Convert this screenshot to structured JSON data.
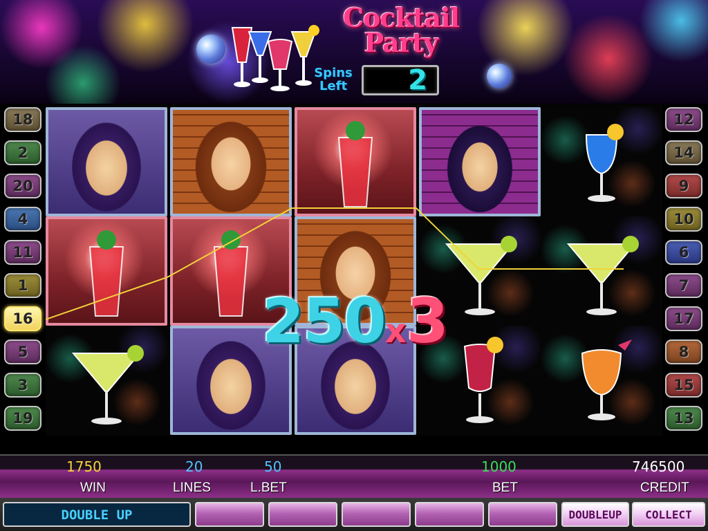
{
  "game": {
    "title_line1": "Cocktail",
    "title_line2": "Party",
    "spins_label_line1": "Spins",
    "spins_label_line2": "Left",
    "spins_left": "2"
  },
  "left_lines": [
    "18",
    "2",
    "20",
    "4",
    "11",
    "1",
    "16",
    "5",
    "3",
    "19"
  ],
  "right_lines": [
    "12",
    "14",
    "9",
    "10",
    "6",
    "7",
    "17",
    "8",
    "15",
    "13"
  ],
  "reels": [
    [
      "purple-hair-woman",
      "red-cocktail-glow",
      "lime-margarita"
    ],
    [
      "brown-hair-woman",
      "red-cocktail-glow",
      "purple-hair-woman"
    ],
    [
      "red-cocktail-glow",
      "brown-hair-woman",
      "purple-hair-woman"
    ],
    [
      "purple-hair-woman-brick",
      "lime-margarita",
      "red-hurricane-cocktail"
    ],
    [
      "blue-lagoon-cocktail",
      "lime-margarita",
      "tropical-cocktail"
    ]
  ],
  "win_display": {
    "amount": "250",
    "x": "x",
    "multiplier": "3"
  },
  "info": {
    "win_value": "1750",
    "win_label": "WIN",
    "lines_value": "20",
    "lines_label": "LINES",
    "lbet_value": "50",
    "lbet_label": "L.BET",
    "bet_value": "1000",
    "bet_label": "BET",
    "credit_value": "746500",
    "credit_label": "CREDIT"
  },
  "buttons": {
    "double_up": "DOUBLE UP",
    "doubleup_small": "DOUBLEUP",
    "collect": "COLLECT"
  },
  "colors": {
    "win_value": "#f5d53a",
    "lines_value": "#4fc3ff",
    "lbet_value": "#4fc3ff",
    "bet_value": "#39e05a",
    "credit_value": "#ffffff"
  }
}
